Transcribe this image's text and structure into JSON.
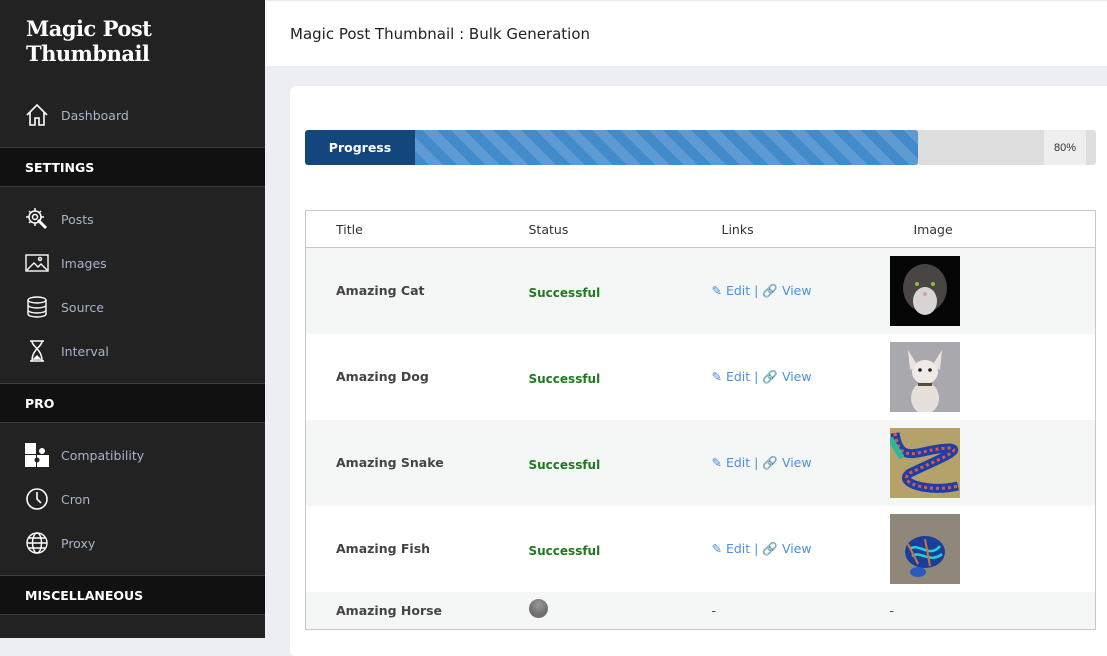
{
  "sidebar": {
    "logo": "Magic Post Thumbnail",
    "dashboard": {
      "label": "Dashboard",
      "icon": "home-icon"
    },
    "sections": [
      {
        "label": "SETTINGS",
        "items": [
          {
            "label": "Posts",
            "icon": "gear-wrench-icon"
          },
          {
            "label": "Images",
            "icon": "image-icon"
          },
          {
            "label": "Source",
            "icon": "database-icon"
          },
          {
            "label": "Interval",
            "icon": "hourglass-icon"
          }
        ]
      },
      {
        "label": "PRO",
        "items": [
          {
            "label": "Compatibility",
            "icon": "puzzle-icon"
          },
          {
            "label": "Cron",
            "icon": "clock-icon"
          },
          {
            "label": "Proxy",
            "icon": "globe-icon"
          }
        ]
      },
      {
        "label": "MISCELLANEOUS",
        "items": []
      }
    ]
  },
  "header": {
    "title": "Magic Post Thumbnail : Bulk Generation"
  },
  "progress": {
    "label": "Progress",
    "percent": 80,
    "percent_text": "80%",
    "colors": {
      "label_bg": "#13467c",
      "stripe_a": "#428bca",
      "stripe_b": "#5e9bd2"
    }
  },
  "table": {
    "headers": [
      "Title",
      "Status",
      "Links",
      "Image"
    ],
    "rows": [
      {
        "title": "Amazing Cat",
        "status": "Successful",
        "edit": "Edit",
        "view": "View",
        "image": "cat thumbnail"
      },
      {
        "title": "Amazing Dog",
        "status": "Successful",
        "edit": "Edit",
        "view": "View",
        "image": "dog thumbnail"
      },
      {
        "title": "Amazing Snake",
        "status": "Successful",
        "edit": "Edit",
        "view": "View",
        "image": "snake thumbnail"
      },
      {
        "title": "Amazing Fish",
        "status": "Successful",
        "edit": "Edit",
        "view": "View",
        "image": "fish thumbnail"
      },
      {
        "title": "Amazing Horse",
        "status": "loading",
        "links": "-",
        "image_text": "-"
      }
    ],
    "separator": "|"
  }
}
